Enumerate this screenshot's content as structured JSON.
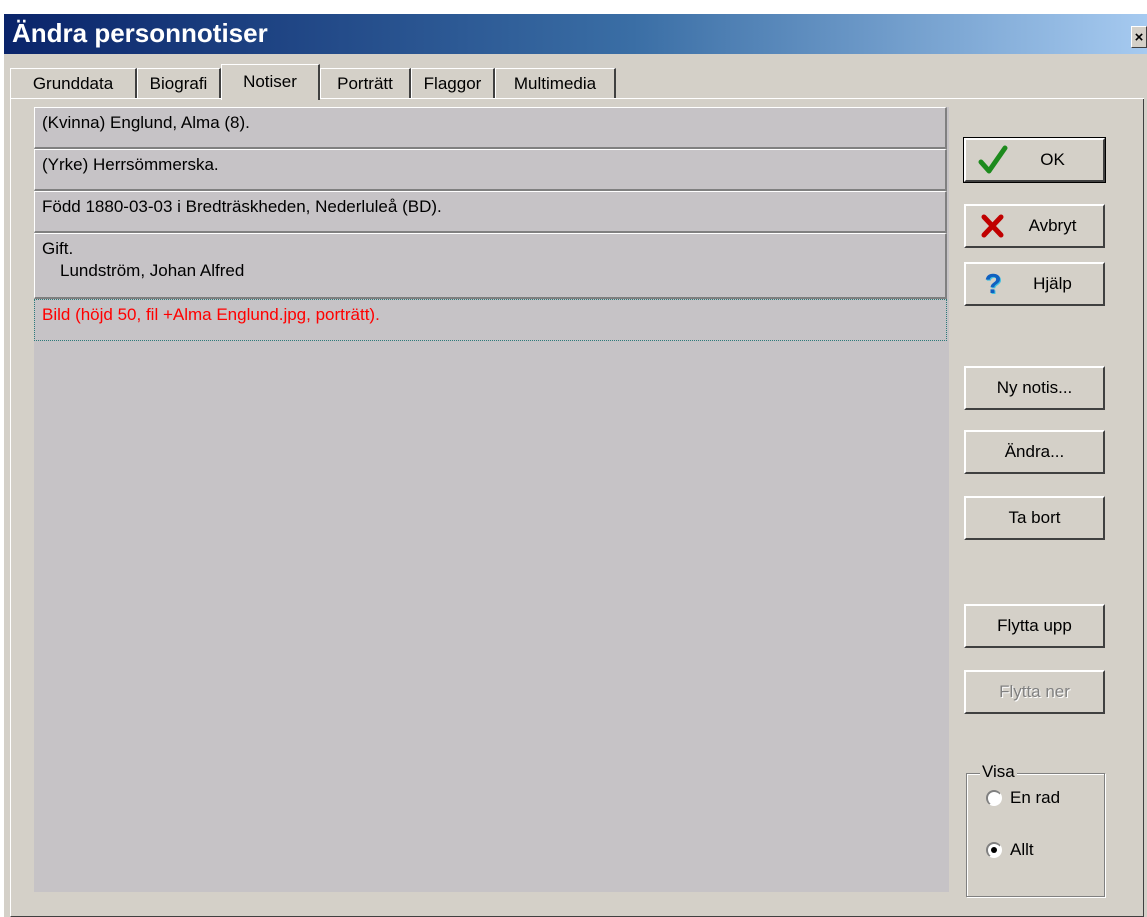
{
  "window": {
    "title": "Ändra personnotiser"
  },
  "tabs": [
    {
      "label": "Grunddata",
      "active": false
    },
    {
      "label": "Biografi",
      "active": false
    },
    {
      "label": "Notiser",
      "active": true
    },
    {
      "label": "Porträtt",
      "active": false
    },
    {
      "label": "Flaggor",
      "active": false
    },
    {
      "label": "Multimedia",
      "active": false
    }
  ],
  "notes": [
    {
      "lines": [
        "(Kvinna) Englund, Alma (8)."
      ],
      "selected": false
    },
    {
      "lines": [
        "(Yrke) Herrsömmerska."
      ],
      "selected": false
    },
    {
      "lines": [
        "Född 1880-03-03 i Bredträskheden, Nederluleå (BD)."
      ],
      "selected": false
    },
    {
      "lines": [
        "Gift.",
        "Lundström, Johan Alfred"
      ],
      "selected": false
    },
    {
      "lines": [
        "Bild (höjd 50, fil +Alma Englund.jpg, porträtt)."
      ],
      "selected": true
    }
  ],
  "buttons": {
    "ok": {
      "label": "OK",
      "icon": "check-icon"
    },
    "cancel": {
      "label": "Avbryt",
      "icon": "x-icon"
    },
    "help": {
      "label": "Hjälp",
      "icon": "question-icon"
    },
    "new_note": {
      "label": "Ny notis..."
    },
    "edit": {
      "label": "Ändra..."
    },
    "delete": {
      "label": "Ta bort"
    },
    "move_up": {
      "label": "Flytta upp"
    },
    "move_down": {
      "label": "Flytta ner",
      "disabled": true
    }
  },
  "visa": {
    "label": "Visa",
    "options": [
      {
        "label": "En rad",
        "selected": false
      },
      {
        "label": "Allt",
        "selected": true
      }
    ]
  },
  "colors": {
    "selected_text": "#ff0000",
    "list_bg": "#c6c3c6",
    "dialog_bg": "#d4d0c8"
  }
}
